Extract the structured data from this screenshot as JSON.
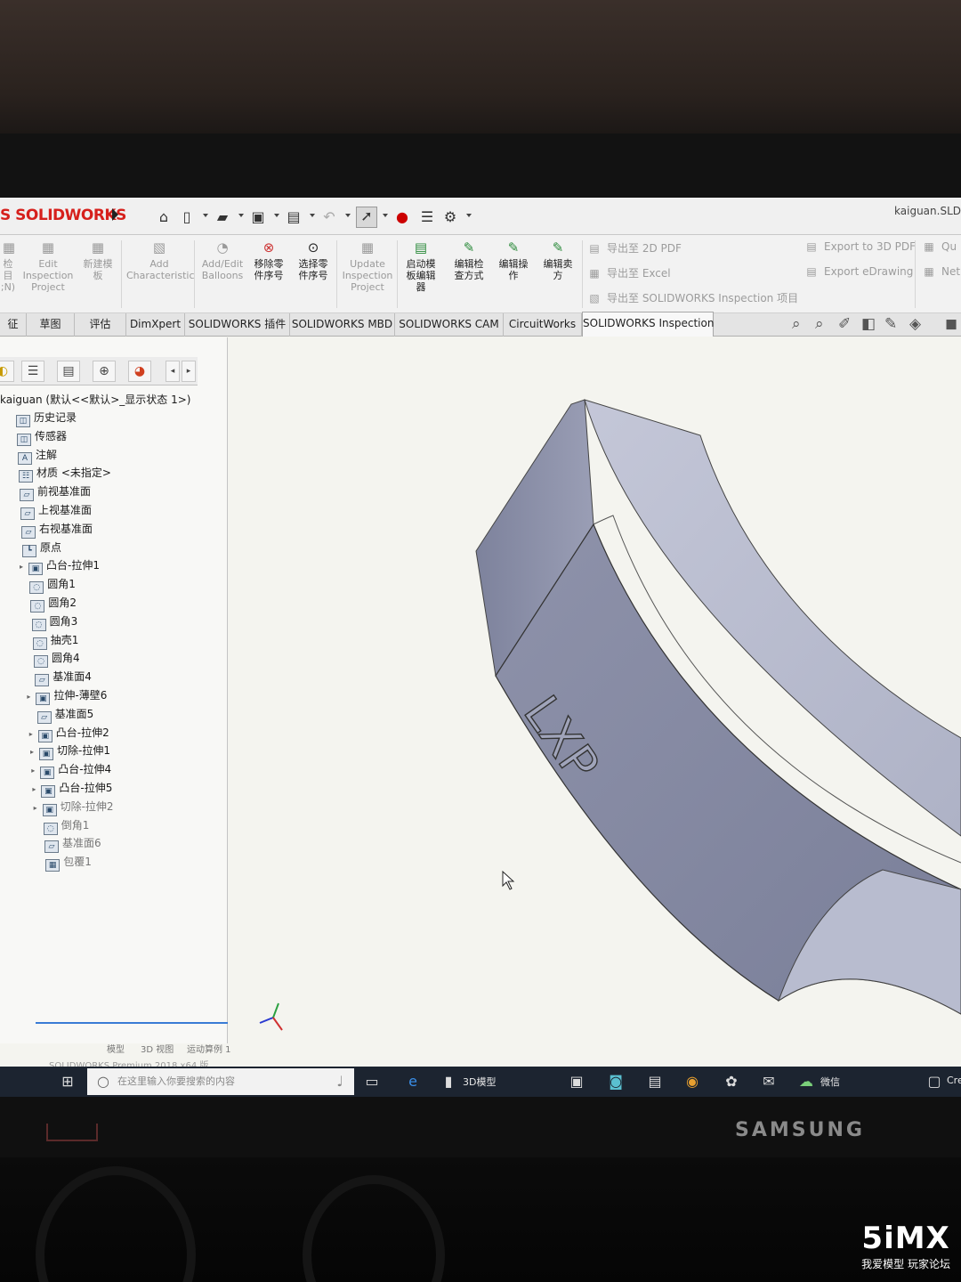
{
  "app": {
    "logo_text": "S SOLIDWORKS",
    "window_title": "kaiguan.SLD",
    "edition": "SOLIDWORKS Premium 2018 x64 版"
  },
  "quick_access": {
    "icons": [
      "home-icon",
      "new-document-icon",
      "open-icon",
      "save-icon",
      "print-icon",
      "undo-icon",
      "select-icon",
      "traffic-light-icon",
      "options-list-icon",
      "gear-icon"
    ]
  },
  "ribbon": {
    "buttons": [
      {
        "label": "检\n目\n;N)",
        "enabled": false
      },
      {
        "label": "Edit\nInspection\nProject",
        "enabled": false
      },
      {
        "label": "新建模\n板",
        "enabled": false
      },
      {
        "label": "Add\nCharacteristic",
        "enabled": false
      },
      {
        "label": "Add/Edit\nBalloons",
        "enabled": false
      },
      {
        "label": "移除零\n件序号",
        "enabled": true
      },
      {
        "label": "选择零\n件序号",
        "enabled": true
      },
      {
        "label": "Update\nInspection\nProject",
        "enabled": false
      },
      {
        "label": "启动模\n板编辑\n器",
        "enabled": true
      },
      {
        "label": "编辑检\n查方式",
        "enabled": true
      },
      {
        "label": "编辑操\n作",
        "enabled": true
      },
      {
        "label": "编辑卖\n方",
        "enabled": true
      }
    ],
    "export_left": [
      "导出至 2D PDF",
      "导出至 Excel",
      "导出至 SOLIDWORKS Inspection 项目"
    ],
    "export_right": [
      "Export to 3D PDF",
      "Export eDrawing"
    ],
    "export_far": [
      "Qu",
      "Net"
    ]
  },
  "tabs": [
    "征",
    "草图",
    "评估",
    "DimXpert",
    "SOLIDWORKS 插件",
    "SOLIDWORKS MBD",
    "SOLIDWORKS CAM",
    "CircuitWorks",
    "SOLIDWORKS Inspection"
  ],
  "active_tab": "SOLIDWORKS Inspection",
  "feature_tree": {
    "root": "kaiguan (默认<<默认>_显示状态 1>)",
    "items": [
      "历史记录",
      "传感器",
      "注解",
      "材质 <未指定>",
      "前视基准面",
      "上视基准面",
      "右视基准面",
      "原点",
      "凸台-拉伸1",
      "圆角1",
      "圆角2",
      "圆角3",
      "抽壳1",
      "圆角4",
      "基准面4",
      "拉伸-薄壁6",
      "基准面5",
      "凸台-拉伸2",
      "切除-拉伸1",
      "凸台-拉伸4",
      "凸台-拉伸5",
      "切除-拉伸2",
      "倒角1",
      "基准面6",
      "包覆1"
    ]
  },
  "model": {
    "embossed_text": "LXP"
  },
  "bottom_tabs": [
    "模型",
    "3D 视图",
    "运动算例 1"
  ],
  "taskbar": {
    "search_placeholder": "在这里输入你要搜索的内容",
    "window_label": "3D模型",
    "wechat_label": "微信",
    "far_right": "Cre"
  },
  "monitor": {
    "brand": "SAMSUNG"
  },
  "watermark": {
    "big": "5iMX",
    "small": "我爱模型 玩家论坛"
  }
}
